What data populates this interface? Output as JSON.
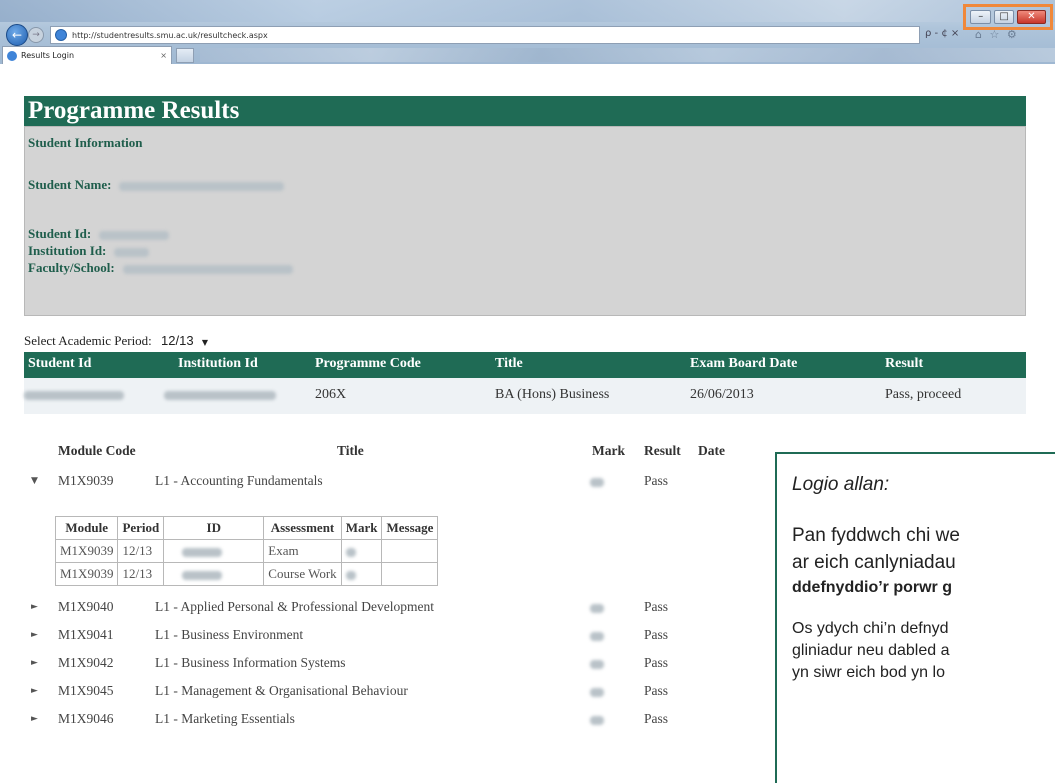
{
  "browser": {
    "url": "http://studentresults.smu.ac.uk/resultcheck.aspx",
    "tab_label": "Results Login",
    "tab_close": "×",
    "address_tools": "ρ - ¢ ×",
    "toolbar_icons": "⌂ ☆ ⚙",
    "back_glyph": "←",
    "forward_glyph": "→",
    "window_controls": {
      "minimize": "–",
      "maximize": "□",
      "close": "✕"
    }
  },
  "header": {
    "title": "Programme Results"
  },
  "student_info": {
    "section_label": "Student Information",
    "name_label": "Student Name:",
    "id_label": "Student Id:",
    "institution_label": "Institution Id:",
    "faculty_label": "Faculty/School:"
  },
  "period": {
    "label": "Select Academic Period:",
    "value": "12/13",
    "caret": "▼"
  },
  "programme_table": {
    "headers": [
      "Student Id",
      "Institution Id",
      "Programme Code",
      "Title",
      "Exam Board Date",
      "Result"
    ],
    "row": {
      "programme_code": "206X",
      "title": "BA (Hons) Business",
      "exam_board_date": "26/06/2013",
      "result": "Pass, proceed"
    }
  },
  "modules": {
    "headers": {
      "code": "Module Code",
      "title": "Title",
      "mark": "Mark",
      "result": "Result",
      "date": "Date"
    },
    "expanded_glyph": "▼",
    "collapsed_glyph": "►",
    "rows": [
      {
        "code": "M1X9039",
        "title": "L1 - Accounting Fundamentals",
        "result": "Pass"
      },
      {
        "code": "M1X9040",
        "title": "L1 - Applied Personal & Professional Development",
        "result": "Pass"
      },
      {
        "code": "M1X9041",
        "title": "L1 - Business Environment",
        "result": "Pass"
      },
      {
        "code": "M1X9042",
        "title": "L1 - Business Information Systems",
        "result": "Pass"
      },
      {
        "code": "M1X9045",
        "title": "L1 - Management & Organisational Behaviour",
        "result": "Pass"
      },
      {
        "code": "M1X9046",
        "title": "L1 - Marketing Essentials",
        "result": "Pass"
      }
    ]
  },
  "assessments": {
    "headers": [
      "Module",
      "Period",
      "ID",
      "Assessment",
      "Mark",
      "Message"
    ],
    "rows": [
      {
        "module": "M1X9039",
        "period": "12/13",
        "assessment": "Exam"
      },
      {
        "module": "M1X9039",
        "period": "12/13",
        "assessment": "Course Work"
      }
    ]
  },
  "notice": {
    "title": "Logio allan:",
    "line1": "Pan fyddwch chi we",
    "line2": "ar eich canlyniadau",
    "bold": "ddefnyddio’r porwr g",
    "line3": "Os ydych chi’n defnyd",
    "line4": "gliniadur neu dabled a",
    "line5": "yn siwr eich bod yn lo"
  },
  "colors": {
    "brand_green": "#1f6b55",
    "panel_grey": "#d4d4d4",
    "highlight_orange": "#f0883a"
  }
}
